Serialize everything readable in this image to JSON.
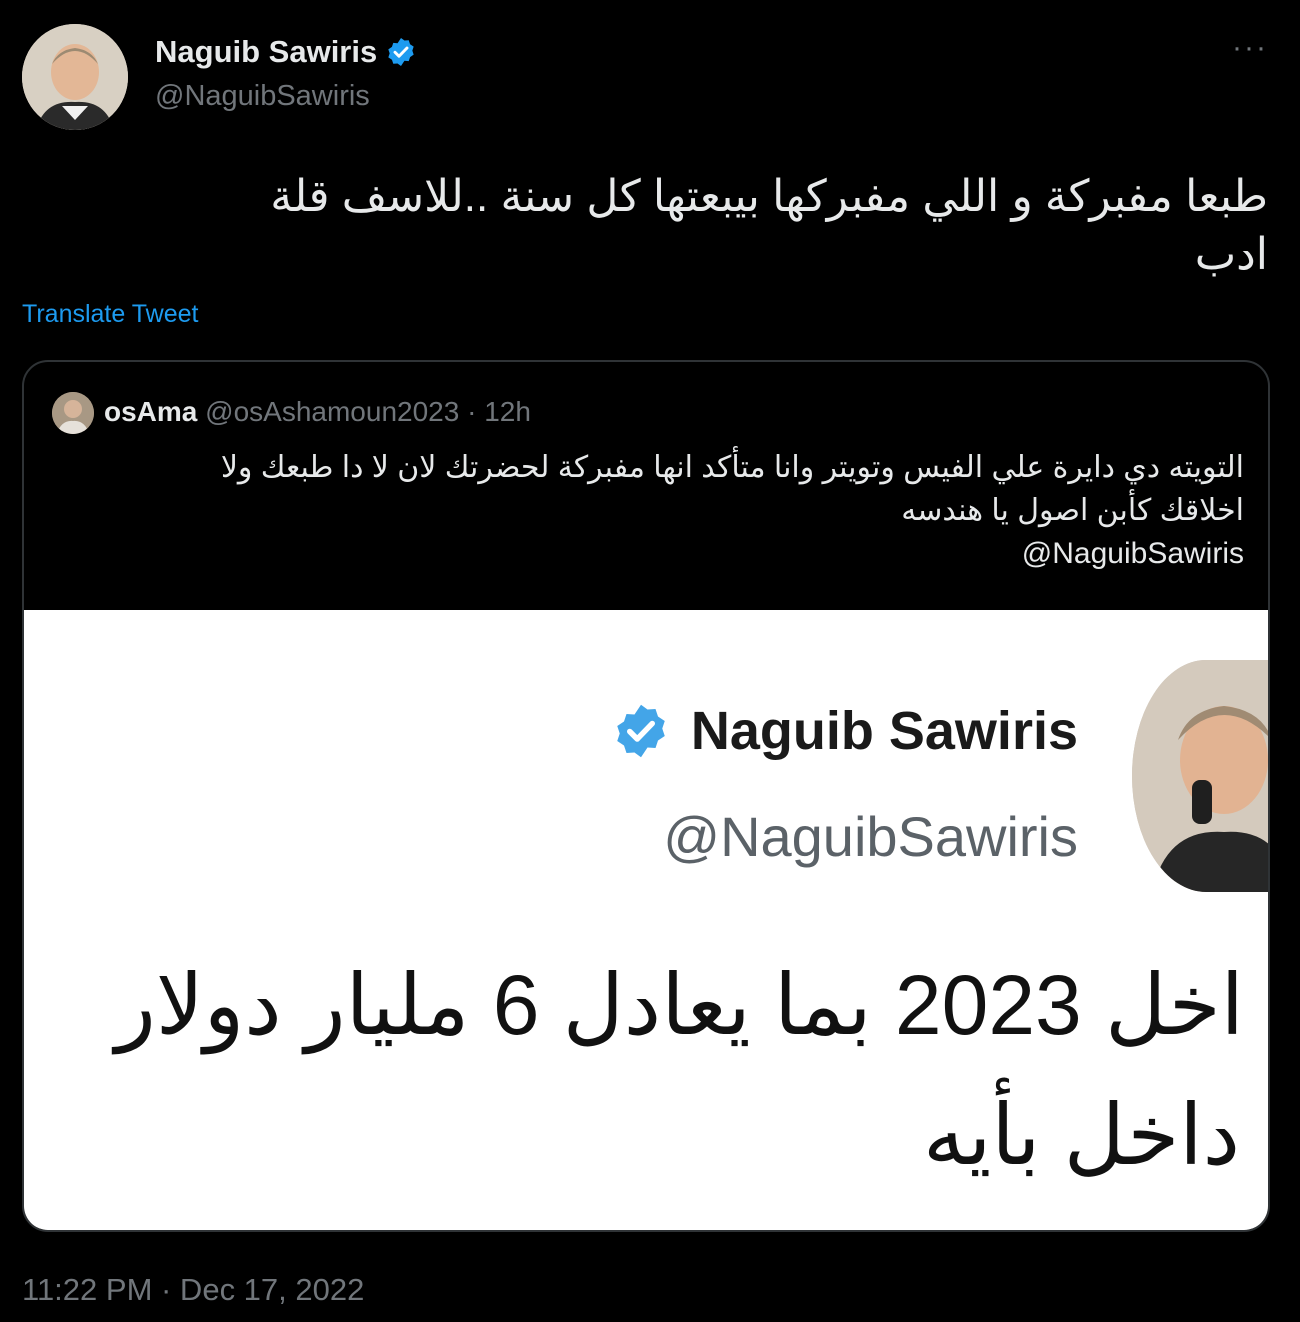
{
  "tweet": {
    "author_name": "Naguib Sawiris",
    "author_handle": "@NaguibSawiris",
    "text_line1": "طبعا مفبركة و اللي مفبركها بيبعتها  كل سنة ..للاسف قلة",
    "text_line2": "ادب",
    "translate_label": "Translate Tweet",
    "timestamp": "11:22 PM · Dec 17, 2022",
    "more_label": "···"
  },
  "quote": {
    "name": "osAma",
    "handle": "@osAshamoun2023",
    "separator": " · ",
    "age": "12h",
    "text_line1": "التويته دي دايرة علي الفيس وتويتر وانا متأكد انها مفبركة لحضرتك لان لا دا طبعك ولا",
    "text_line2": "اخلاقك كأبن اصول يا هندسه",
    "mention": "@NaguibSawiris",
    "image": {
      "name": "Naguib Sawiris",
      "handle": "@NaguibSawiris",
      "line1": "اخل 2023 بما يعادل 6 مليار دولار",
      "line2": "داخل بأيه"
    }
  },
  "colors": {
    "background": "#000000",
    "text": "#e7e9ea",
    "secondary": "#71767b",
    "link": "#1d9bf0",
    "verified": "#1d9bf0",
    "card_border": "#2f3336"
  },
  "icons": {
    "verified": "verified-badge-icon",
    "more": "more-horizontal-icon"
  }
}
